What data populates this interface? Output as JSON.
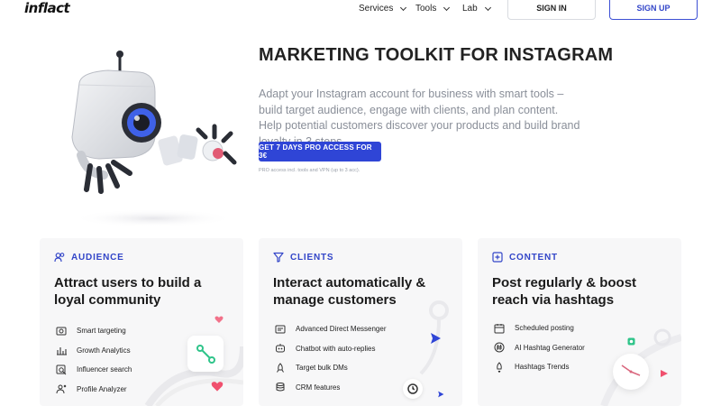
{
  "header": {
    "logo": "inflact",
    "nav": [
      {
        "label": "Services"
      },
      {
        "label": "Tools"
      },
      {
        "label": "Lab"
      }
    ],
    "sign_in": "SIGN IN",
    "sign_up": "SIGN UP"
  },
  "hero": {
    "title": "MARKETING TOOLKIT FOR INSTAGRAM",
    "description": "Adapt your Instagram account for business with smart tools – build target audience, engage with clients, and plan content. Help potential customers discover your products and build brand loyalty in 3 steps.",
    "cta": "GET 7 DAYS PRO ACCESS FOR 3€",
    "cta_note": "PRO access incl. tools and VPN (up to 3 acc)."
  },
  "cards": [
    {
      "label": "AUDIENCE",
      "title": "Attract users to build a loyal community",
      "items": [
        {
          "label": "Smart targeting",
          "icon": "target-icon"
        },
        {
          "label": "Growth Analytics",
          "icon": "bar-chart-icon"
        },
        {
          "label": "Influencer search",
          "icon": "search-user-icon"
        },
        {
          "label": "Profile Analyzer",
          "icon": "profile-analyzer-icon"
        }
      ]
    },
    {
      "label": "CLIENTS",
      "title": "Interact automatically & manage customers",
      "items": [
        {
          "label": "Advanced Direct Messenger",
          "icon": "messenger-icon"
        },
        {
          "label": "Chatbot with auto-replies",
          "icon": "chatbot-icon"
        },
        {
          "label": "Target bulk DMs",
          "icon": "rocket-icon"
        },
        {
          "label": "CRM features",
          "icon": "database-icon"
        }
      ]
    },
    {
      "label": "CONTENT",
      "title": "Post regularly & boost reach via hashtags",
      "items": [
        {
          "label": "Scheduled posting",
          "icon": "calendar-icon"
        },
        {
          "label": "AI Hashtag Generator",
          "icon": "hashtag-icon"
        },
        {
          "label": "Hashtags Trends",
          "icon": "trend-rocket-icon"
        }
      ]
    }
  ],
  "colors": {
    "accent": "#2f45d6",
    "heart": "#f0506e"
  }
}
